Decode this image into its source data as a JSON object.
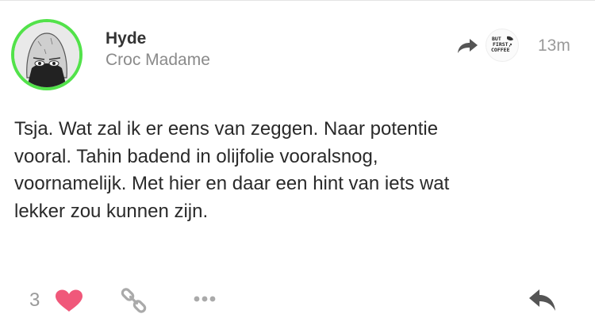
{
  "post": {
    "author": "Hyde",
    "subtitle": "Croc Madame",
    "time": "13m",
    "venue_logo_text": [
      "BUT",
      "FIRST,",
      "COFFEE"
    ],
    "body_lines": [
      "Tsja. Wat zal ik er eens van zeggen. Naar potentie",
      "vooral. Tahin badend in olijfolie vooralsnog,",
      "voornamelijk. Met hier en daar een hint van iets wat",
      "lekker zou kunnen zijn."
    ]
  },
  "actions": {
    "like_count": "3"
  },
  "colors": {
    "avatar_ring": "#52e24a",
    "heart": "#f0587a",
    "icon_gray": "#555555"
  },
  "icons": {
    "share": "share-arrow-icon",
    "heart": "heart-icon",
    "link": "link-icon",
    "more": "more-dots-icon",
    "reply": "reply-arrow-icon"
  }
}
